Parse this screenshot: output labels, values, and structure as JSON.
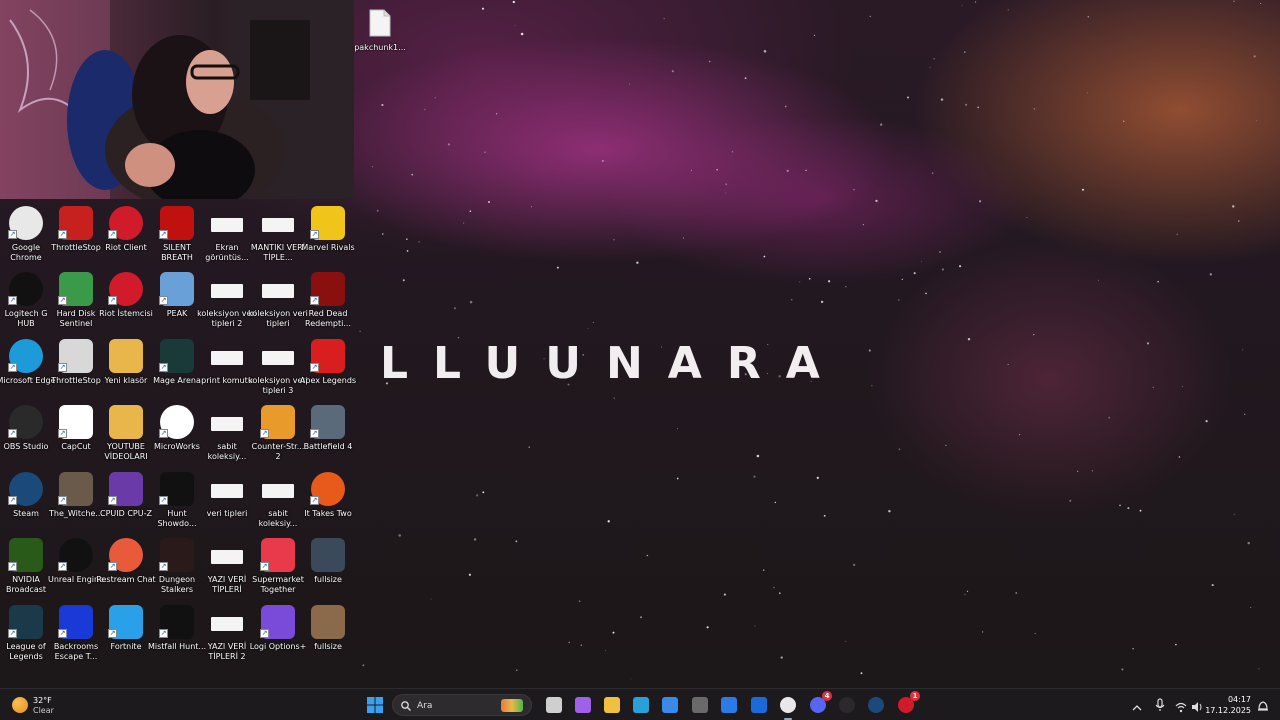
{
  "desktop": {
    "wallpaper_logo": "LLUUNARA",
    "top_file": {
      "label": "pakchunk1...",
      "icon": "file-icon"
    },
    "icons": [
      {
        "label": "Google Chrome",
        "icon": "chrome-icon",
        "color": "#e8e8e8"
      },
      {
        "label": "ThrottleStop",
        "icon": "throttlestop-icon",
        "color": "#c8201e"
      },
      {
        "label": "Riot Client",
        "icon": "riot-icon",
        "color": "#d11a2a"
      },
      {
        "label": "SILENT BREATH",
        "icon": "silent-breath-icon",
        "color": "#c01010"
      },
      {
        "label": "Ekran görüntüs...",
        "icon": "image-file-icon",
        "color": "#f4f4f4"
      },
      {
        "label": "MANTIKI VERİ TİPLE...",
        "icon": "image-file-icon",
        "color": "#f4f4f4"
      },
      {
        "label": "Marvel Rivals",
        "icon": "marvel-rivals-icon",
        "color": "#f0c419"
      },
      {
        "label": "Logitech G HUB",
        "icon": "logitech-icon",
        "color": "#111111"
      },
      {
        "label": "Hard Disk Sentinel",
        "icon": "hard-disk-sentinel-icon",
        "color": "#3a9a4a"
      },
      {
        "label": "Riot İstemcisi",
        "icon": "riot-icon",
        "color": "#d11a2a"
      },
      {
        "label": "PEAK",
        "icon": "peak-icon",
        "color": "#6aa0d8"
      },
      {
        "label": "koleksiyon veri tipleri 2",
        "icon": "image-file-icon",
        "color": "#f4f4f4"
      },
      {
        "label": "koleksiyon veri tipleri",
        "icon": "image-file-icon",
        "color": "#f4f4f4"
      },
      {
        "label": "Red Dead Redempti...",
        "icon": "red-dead-icon",
        "color": "#8a1010"
      },
      {
        "label": "Microsoft Edge",
        "icon": "edge-icon",
        "color": "#1d9bd8"
      },
      {
        "label": "ThrottleStop",
        "icon": "gear-icon",
        "color": "#d8d8d8"
      },
      {
        "label": "Yeni klasör",
        "icon": "folder-icon",
        "color": "#e8b64a"
      },
      {
        "label": "Mage Arena",
        "icon": "mage-arena-icon",
        "color": "#1a3a3a"
      },
      {
        "label": "print komutu",
        "icon": "image-file-icon",
        "color": "#f4f4f4"
      },
      {
        "label": "koleksiyon veri tipleri 3",
        "icon": "image-file-icon",
        "color": "#f4f4f4"
      },
      {
        "label": "Apex Legends",
        "icon": "apex-icon",
        "color": "#d81e1e"
      },
      {
        "label": "OBS Studio",
        "icon": "obs-icon",
        "color": "#2a2a2a"
      },
      {
        "label": "CapCut",
        "icon": "capcut-icon",
        "color": "#ffffff"
      },
      {
        "label": "YOUTUBE VİDEOLARI",
        "icon": "folder-icon",
        "color": "#e8b64a"
      },
      {
        "label": "MicroWorks",
        "icon": "microworks-icon",
        "color": "#ffffff"
      },
      {
        "label": "sabit koleksiy...",
        "icon": "image-file-icon",
        "color": "#f4f4f4"
      },
      {
        "label": "Counter-Str... 2",
        "icon": "counter-strike-icon",
        "color": "#e89a2a"
      },
      {
        "label": "Battlefield 4",
        "icon": "battlefield-icon",
        "color": "#5a6a7a"
      },
      {
        "label": "Steam",
        "icon": "steam-icon",
        "color": "#1b4a7a"
      },
      {
        "label": "The_Witche...",
        "icon": "witcher-icon",
        "color": "#6a5a4a"
      },
      {
        "label": "CPUID CPU-Z",
        "icon": "cpuz-icon",
        "color": "#6a3aa8"
      },
      {
        "label": "Hunt Showdo...",
        "icon": "hunt-icon",
        "color": "#111111"
      },
      {
        "label": "veri tipleri",
        "icon": "image-file-icon",
        "color": "#f4f4f4"
      },
      {
        "label": "sabit koleksiy...",
        "icon": "image-file-icon",
        "color": "#f4f4f4"
      },
      {
        "label": "It Takes Two",
        "icon": "it-takes-two-icon",
        "color": "#e85a1a"
      },
      {
        "label": "NVIDIA Broadcast",
        "icon": "nvidia-icon",
        "color": "#2a5a1a"
      },
      {
        "label": "Unreal Engine",
        "icon": "unreal-icon",
        "color": "#111111"
      },
      {
        "label": "Restream Chat",
        "icon": "restream-icon",
        "color": "#e85a3a"
      },
      {
        "label": "Dungeon Stalkers",
        "icon": "dungeon-stalkers-icon",
        "color": "#2a1a1a"
      },
      {
        "label": "YAZI VERİ TİPLERİ",
        "icon": "image-file-icon",
        "color": "#f4f4f4"
      },
      {
        "label": "Supermarket Together",
        "icon": "supermarket-icon",
        "color": "#e83a4a"
      },
      {
        "label": "fullsize",
        "icon": "image-thumb-icon",
        "color": "#3a4a5a"
      },
      {
        "label": "League of Legends",
        "icon": "league-icon",
        "color": "#1a3a4a"
      },
      {
        "label": "Backrooms Escape T...",
        "icon": "backrooms-icon",
        "color": "#1a3ad8"
      },
      {
        "label": "Fortnite",
        "icon": "fortnite-icon",
        "color": "#2aa0e8"
      },
      {
        "label": "Mistfall Hunt...",
        "icon": "mistfall-icon",
        "color": "#111111"
      },
      {
        "label": "YAZI VERİ TİPLERİ 2",
        "icon": "image-file-icon",
        "color": "#f4f4f4"
      },
      {
        "label": "Logi Options+",
        "icon": "logi-options-icon",
        "color": "#7a4ad8"
      },
      {
        "label": "fullsize",
        "icon": "image-thumb-icon",
        "color": "#8a6a4a"
      }
    ]
  },
  "taskbar": {
    "weather": {
      "temp": "32°F",
      "condition": "Clear",
      "icon": "weather-moon-icon"
    },
    "search_placeholder": "Ara",
    "apps": [
      {
        "name": "start-button",
        "icon": "windows-icon",
        "color": "#3a9ae8"
      },
      {
        "name": "task-view",
        "icon": "task-view-icon",
        "color": "#cfcfcf"
      },
      {
        "name": "copilot",
        "icon": "copilot-icon",
        "color": "#a060e8"
      },
      {
        "name": "file-explorer",
        "icon": "folder-icon",
        "color": "#f0c040"
      },
      {
        "name": "edge",
        "icon": "edge-icon",
        "color": "#2aa0d8"
      },
      {
        "name": "store",
        "icon": "store-icon",
        "color": "#3a8ae8"
      },
      {
        "name": "app-dark",
        "icon": "app-icon",
        "color": "#6a6a6a"
      },
      {
        "name": "vscode-like",
        "icon": "code-icon",
        "color": "#2a7ae8"
      },
      {
        "name": "outlook",
        "icon": "mail-icon",
        "color": "#1a6ad8"
      },
      {
        "name": "chrome",
        "icon": "chrome-icon",
        "color": "#e8e8e8"
      },
      {
        "name": "discord",
        "icon": "discord-icon",
        "color": "#5865f2"
      },
      {
        "name": "obs",
        "icon": "obs-icon",
        "color": "#2a2a2a"
      },
      {
        "name": "steam",
        "icon": "steam-icon",
        "color": "#1b4a7a"
      },
      {
        "name": "riot",
        "icon": "riot-icon",
        "color": "#d11a2a"
      }
    ],
    "badges": {
      "discord": "4",
      "riot": "1"
    },
    "time": "04:17",
    "date": "17.12.2025"
  }
}
